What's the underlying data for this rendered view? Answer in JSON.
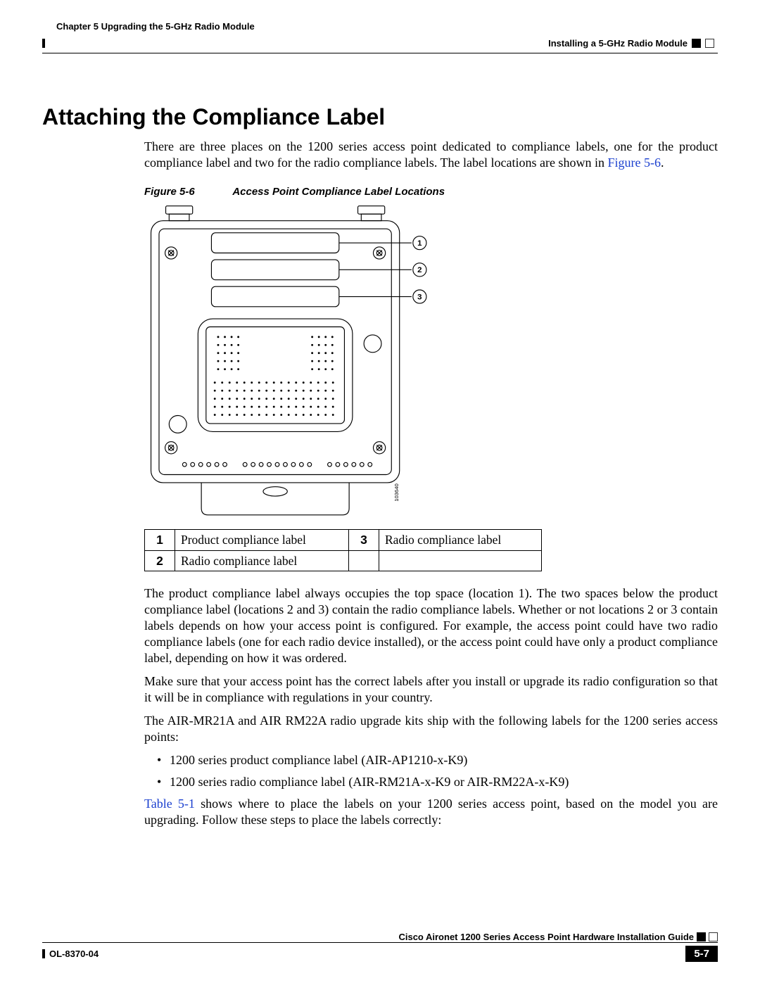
{
  "header": {
    "chapter": "Chapter 5      Upgrading the 5-GHz Radio Module",
    "section": "Installing a 5-GHz Radio Module"
  },
  "title": "Attaching the Compliance Label",
  "intro_text_a": "There are three places on the 1200 series access point dedicated to compliance labels, one for the product compliance label and two for the radio compliance labels. The label locations are shown in ",
  "intro_xref": "Figure 5-6",
  "intro_text_b": ".",
  "figure": {
    "number": "Figure 5-6",
    "title": "Access Point Compliance Label Locations",
    "id_number": "103640",
    "callouts": [
      "1",
      "2",
      "3"
    ]
  },
  "legend": {
    "r1c1k": "1",
    "r1c1v": "Product compliance label",
    "r1c2k": "3",
    "r1c2v": "Radio compliance label",
    "r2c1k": "2",
    "r2c1v": "Radio compliance label",
    "r2c2k": "",
    "r2c2v": ""
  },
  "para2": "The product compliance label always occupies the top space (location 1). The two spaces below the product compliance label (locations 2 and 3) contain the radio compliance labels. Whether or not locations 2 or 3 contain labels depends on how your access point is configured. For example, the access point could have two radio compliance labels (one for each radio device installed), or the access point could have only a product compliance label, depending on how it was ordered.",
  "para3": "Make sure that your access point has the correct labels after you install or upgrade its radio configuration so that it will be in compliance with regulations in your country.",
  "para4": "The AIR-MR21A and AIR RM22A radio upgrade kits ship with the following labels for the 1200 series access points:",
  "bullets": [
    "1200 series product compliance label (AIR-AP1210-x-K9)",
    "1200 series radio compliance label (AIR-RM21A-x-K9 or AIR-RM22A-x-K9)"
  ],
  "para5_xref": "Table 5-1",
  "para5_text": " shows where to place the labels on your 1200 series access point, based on the model you are upgrading. Follow these steps to place the labels correctly:",
  "footer": {
    "guide": "Cisco Aironet 1200 Series Access Point Hardware Installation Guide",
    "docnum": "OL-8370-04",
    "pagenum": "5-7"
  }
}
